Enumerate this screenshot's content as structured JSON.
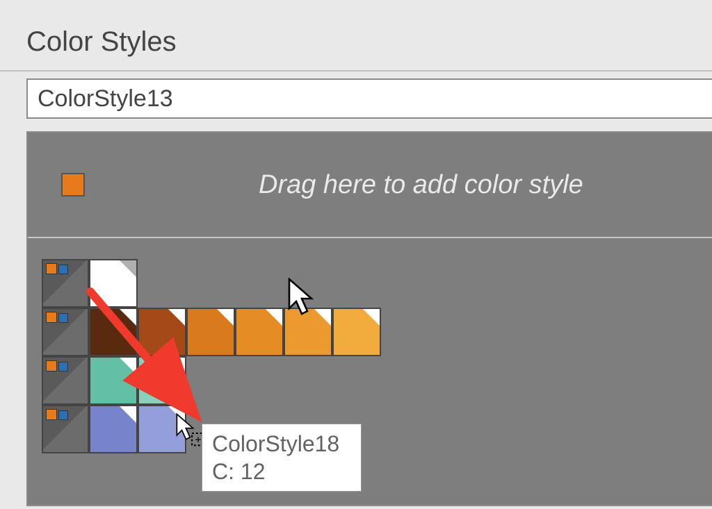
{
  "panel": {
    "title": "Color Styles"
  },
  "nameField": {
    "value": "ColorStyle13"
  },
  "dropHint": "Drag here to add color style",
  "rows": {
    "row1": [
      {
        "color": "#ffffff",
        "white": true
      }
    ],
    "row2": [
      {
        "color": "#5a2a0f"
      },
      {
        "color": "#a34a17"
      },
      {
        "color": "#d97a1d"
      },
      {
        "color": "#e68c25"
      },
      {
        "color": "#ea9a2e"
      },
      {
        "color": "#f1ac3d"
      }
    ],
    "row3": [
      {
        "color": "#63c0a4"
      },
      {
        "color": "#8bd0bb"
      }
    ],
    "row4": [
      {
        "color": "#7784cc"
      },
      {
        "color": "#949ed8"
      }
    ]
  },
  "tooltip": {
    "line1": "ColorStyle18",
    "line2": "C: 12"
  },
  "colors": {
    "preview": "#e77b1b"
  }
}
